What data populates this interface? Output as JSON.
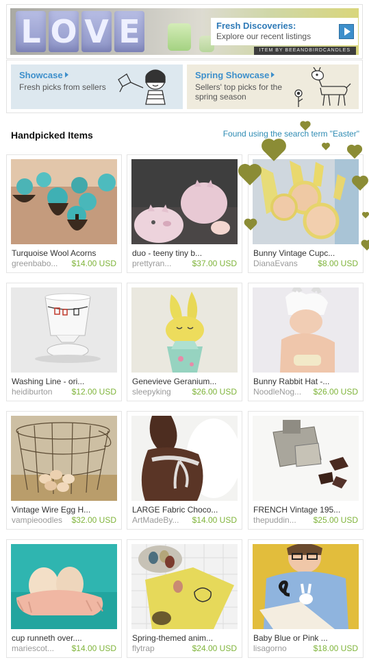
{
  "hero": {
    "love_letters": [
      "L",
      "O",
      "V",
      "E"
    ],
    "fresh_title": "Fresh Discoveries:",
    "fresh_sub": "Explore our recent listings",
    "credit": "ITEM BY BEEANDBIRDCANDLES"
  },
  "showcases": [
    {
      "title": "Showcase",
      "sub": "Fresh picks from sellers"
    },
    {
      "title": "Spring Showcase",
      "sub": "Sellers' top picks for the spring season"
    }
  ],
  "section": {
    "title": "Handpicked Items",
    "search_note": "Found using the search term \"Easter\""
  },
  "items": [
    {
      "title": "Turquoise Wool Acorns",
      "seller": "greenbabo...",
      "price": "$14.00 USD"
    },
    {
      "title": "duo - teeny tiny b...",
      "seller": "prettyran...",
      "price": "$37.00 USD"
    },
    {
      "title": "Bunny Vintage Cupc...",
      "seller": "DianaEvans",
      "price": "$8.00 USD"
    },
    {
      "title": "Washing Line - ori...",
      "seller": "heidiburton",
      "price": "$12.00 USD"
    },
    {
      "title": "Genevieve Geranium...",
      "seller": "sleepyking",
      "price": "$26.00 USD"
    },
    {
      "title": "Bunny Rabbit Hat -...",
      "seller": "NoodleNog...",
      "price": "$26.00 USD"
    },
    {
      "title": "Vintage Wire Egg H...",
      "seller": "vampieoodles",
      "price": "$32.00 USD"
    },
    {
      "title": "LARGE Fabric Choco...",
      "seller": "ArtMadeBy...",
      "price": "$14.00 USD"
    },
    {
      "title": "FRENCH Vintage 195...",
      "seller": "thepuddin...",
      "price": "$25.00 USD"
    },
    {
      "title": "cup runneth over....",
      "seller": "mariescot...",
      "price": "$14.00 USD"
    },
    {
      "title": "Spring-themed anim...",
      "seller": "flytrap",
      "price": "$24.00 USD"
    },
    {
      "title": "Baby Blue or Pink ...",
      "seller": "lisagorno",
      "price": "$18.00 USD"
    }
  ],
  "colors": {
    "link_blue": "#3d8fcb",
    "price_green": "#7fb43a",
    "heart_olive": "#8b8c35"
  }
}
